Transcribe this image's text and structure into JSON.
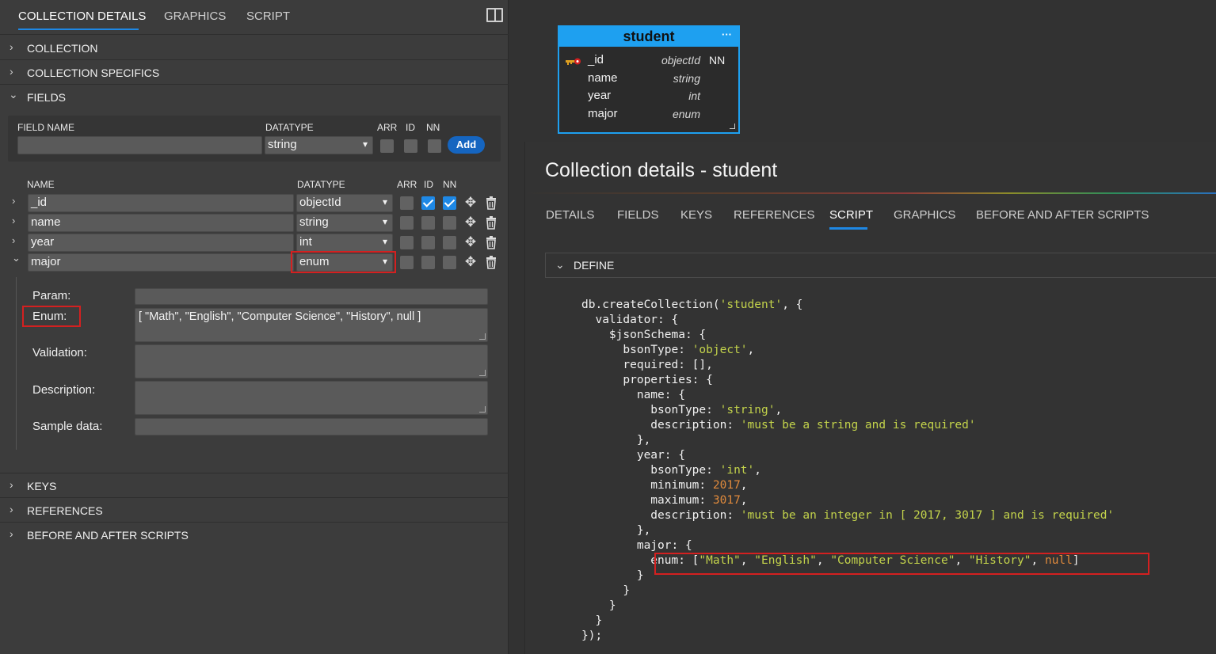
{
  "left_tabs": [
    "COLLECTION DETAILS",
    "GRAPHICS",
    "SCRIPT"
  ],
  "sections": {
    "collection": "COLLECTION",
    "collection_specifics": "COLLECTION SPECIFICS",
    "fields": "FIELDS",
    "keys": "KEYS",
    "references": "REFERENCES",
    "before_after": "BEFORE AND AFTER SCRIPTS"
  },
  "new_field": {
    "headers": {
      "field_name": "FIELD NAME",
      "datatype": "DATATYPE",
      "arr": "ARR",
      "id": "ID",
      "nn": "NN"
    },
    "field_name_value": "",
    "datatype_value": "string",
    "add_label": "Add"
  },
  "field_list": {
    "headers": {
      "name": "NAME",
      "datatype": "DATATYPE",
      "arr": "ARR",
      "id": "ID",
      "nn": "NN"
    },
    "rows": [
      {
        "name": "_id",
        "datatype": "objectId",
        "arr": false,
        "id": true,
        "nn": true,
        "expanded": false
      },
      {
        "name": "name",
        "datatype": "string",
        "arr": false,
        "id": false,
        "nn": false,
        "expanded": false
      },
      {
        "name": "year",
        "datatype": "int",
        "arr": false,
        "id": false,
        "nn": false,
        "expanded": false
      },
      {
        "name": "major",
        "datatype": "enum",
        "arr": false,
        "id": false,
        "nn": false,
        "expanded": true
      }
    ]
  },
  "field_detail": {
    "param_label": "Param:",
    "param_value": "",
    "enum_label": "Enum:",
    "enum_value": "[ \"Math\", \"English\", \"Computer Science\", \"History\", null ]",
    "validation_label": "Validation:",
    "validation_value": "",
    "description_label": "Description:",
    "description_value": "",
    "sample_label": "Sample data:",
    "sample_value": ""
  },
  "entity": {
    "name": "student",
    "menu": "···",
    "fields": [
      {
        "name": "_id",
        "type": "objectId",
        "flag": "NN"
      },
      {
        "name": "name",
        "type": "string",
        "flag": ""
      },
      {
        "name": "year",
        "type": "int",
        "flag": ""
      },
      {
        "name": "major",
        "type": "enum",
        "flag": ""
      }
    ]
  },
  "dialog": {
    "title": "Collection details - student",
    "tabs": [
      "DETAILS",
      "FIELDS",
      "KEYS",
      "REFERENCES",
      "SCRIPT",
      "GRAPHICS",
      "BEFORE AND AFTER SCRIPTS"
    ],
    "active_tab": "SCRIPT",
    "define_label": "DEFINE"
  },
  "script_lines": [
    [
      "db.createCollection(",
      [
        "s",
        "'student'"
      ],
      ", {"
    ],
    [
      "  validator: {"
    ],
    [
      "    $jsonSchema: {"
    ],
    [
      "      bsonType: ",
      [
        "s",
        "'object'"
      ],
      ","
    ],
    [
      "      required: [],"
    ],
    [
      "      properties: {"
    ],
    [
      "        name: {"
    ],
    [
      "          bsonType: ",
      [
        "s",
        "'string'"
      ],
      ","
    ],
    [
      "          description: ",
      [
        "s",
        "'must be a string and is required'"
      ]
    ],
    [
      "        },"
    ],
    [
      "        year: {"
    ],
    [
      "          bsonType: ",
      [
        "s",
        "'int'"
      ],
      ","
    ],
    [
      "          minimum: ",
      [
        "n",
        "2017"
      ],
      ","
    ],
    [
      "          maximum: ",
      [
        "n",
        "3017"
      ],
      ","
    ],
    [
      "          description: ",
      [
        "s",
        "'must be an integer in [ 2017, 3017 ] and is required'"
      ]
    ],
    [
      "        },"
    ],
    [
      "        major: {"
    ],
    [
      "          enum: [",
      [
        "s",
        "\"Math\""
      ],
      ", ",
      [
        "s",
        "\"English\""
      ],
      ", ",
      [
        "s",
        "\"Computer Science\""
      ],
      ", ",
      [
        "s",
        "\"History\""
      ],
      ", ",
      [
        "n",
        "null"
      ],
      "]"
    ],
    [
      "        }"
    ],
    [
      "      }"
    ],
    [
      "    }"
    ],
    [
      "  }"
    ],
    [
      "});"
    ]
  ],
  "colors": {
    "accent": "#1e88e5",
    "highlight": "#d42020",
    "string": "#c3d34b",
    "number": "#e08a3c"
  }
}
